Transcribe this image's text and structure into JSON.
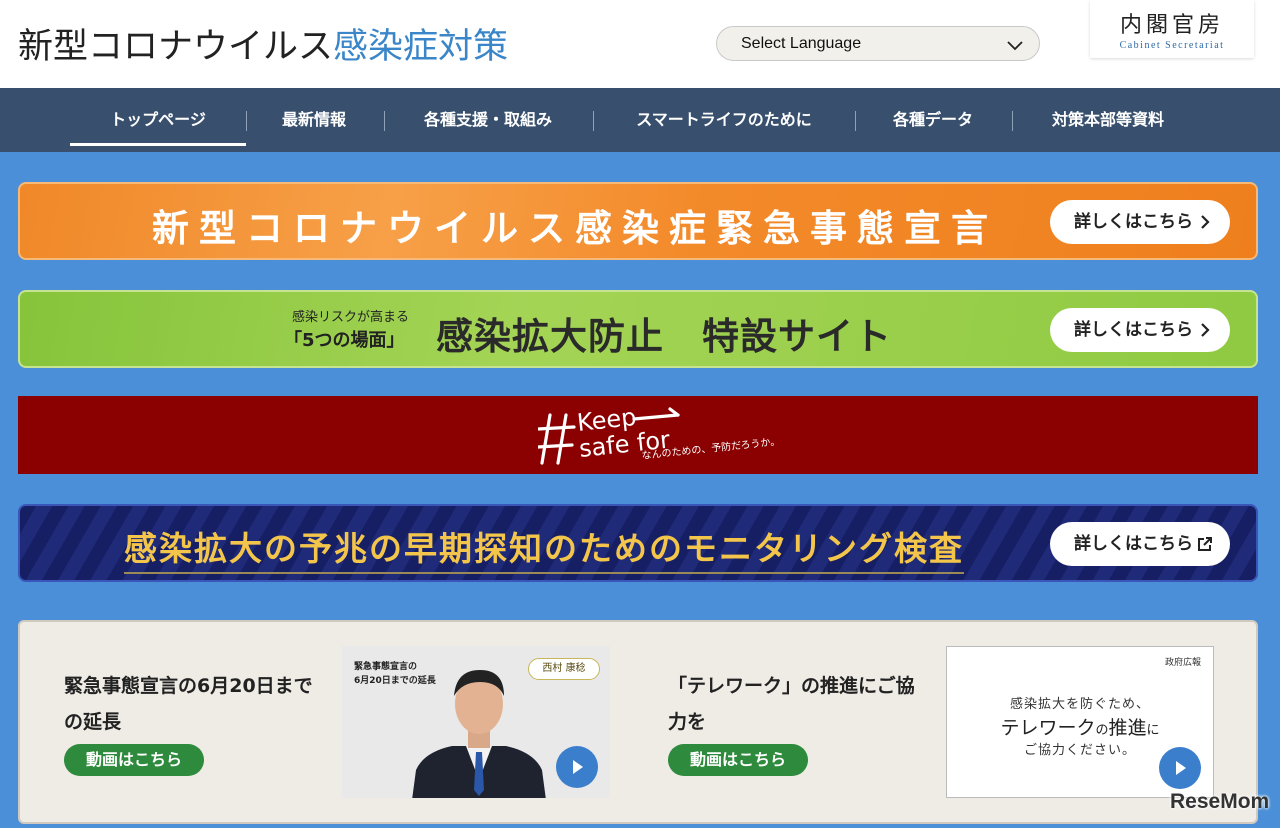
{
  "header": {
    "title_main": "新型コロナウイルス",
    "title_accent": "感染症対策",
    "language_select": "Select Language",
    "agency_jp": "内閣官房",
    "agency_en": "Cabinet Secretariat"
  },
  "nav": {
    "items": [
      {
        "label": "トップページ",
        "active": true
      },
      {
        "label": "最新情報",
        "active": false
      },
      {
        "label": "各種支援・取組み",
        "active": false
      },
      {
        "label": "スマートライフのために",
        "active": false
      },
      {
        "label": "各種データ",
        "active": false
      },
      {
        "label": "対策本部等資料",
        "active": false
      }
    ]
  },
  "banners": {
    "emergency": {
      "text": "新型コロナウイルス感染症緊急事態宣言",
      "button": "詳しくはこちら"
    },
    "five_scenes": {
      "small1": "感染リスクが高まる",
      "small2": "「5つの場面」",
      "main": "感染拡大防止　特設サイト",
      "button": "詳しくはこちら"
    },
    "keep_safe": {
      "line1": "Keep",
      "line2": "safe for",
      "sub": "なんのための、予防だろうか。"
    },
    "monitoring": {
      "text": "感染拡大の予兆の早期探知のためのモニタリング検査",
      "button": "詳しくはこちら"
    }
  },
  "panel": {
    "left": {
      "title": "緊急事態宣言の6月20日までの延長",
      "button": "動画はこちら",
      "thumb_caption_1": "緊急事態宣言の",
      "thumb_caption_2": "6月20日までの延長",
      "thumb_seal": "西村 康稔"
    },
    "right": {
      "title": "「テレワーク」の推進にご協力を",
      "button": "動画はこちら",
      "thumb_source": "政府広報",
      "thumb_l1": "感染拡大を防ぐため、",
      "thumb_l2a": "テレワーク",
      "thumb_l2b": "の",
      "thumb_l2c": "推進",
      "thumb_l2d": "に",
      "thumb_l3": "ご協力ください。"
    }
  },
  "watermark": "ReseMom",
  "colors": {
    "nav_bg": "#38506e",
    "page_bg": "#4a8fd8",
    "accent_blue": "#3a86c8",
    "green_button": "#2e8a3c"
  }
}
